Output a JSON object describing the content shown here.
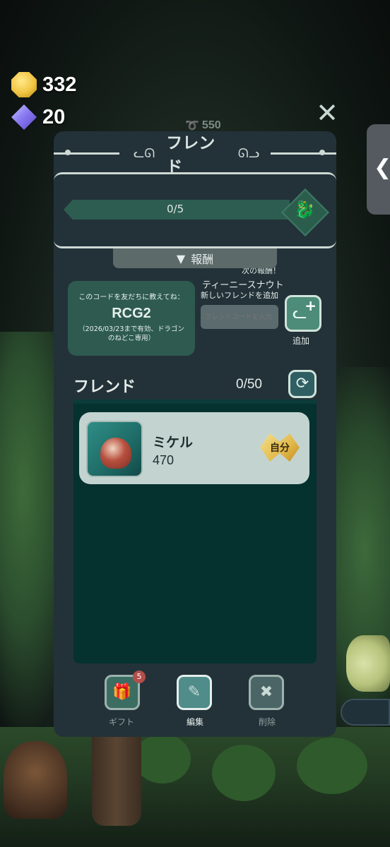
{
  "currencies": {
    "coins": "332",
    "gems": "20"
  },
  "ribbon_count": "550",
  "side_tab": {
    "icon": "chevron-left-icon"
  },
  "panel": {
    "title": "フレンド",
    "progress": {
      "text": "0/5",
      "value": 0,
      "max": 5,
      "next_reward_label": "次の報酬！",
      "next_reward_name": "ティーニースナウト"
    },
    "rewards_toggle": "報酬",
    "code_card": {
      "hint": "このコードを友だちに教えてね：",
      "code": "RCG2",
      "validity": "（2026/03/23まで有効、ドラゴンのねどこ専用）"
    },
    "add_friend": {
      "label": "新しいフレンドを追加",
      "placeholder": "フレンドコードを入力",
      "button_label": "追加"
    },
    "friends": {
      "heading": "フレンド",
      "count": "0/50",
      "list": [
        {
          "name": "ミケル",
          "score": "470",
          "badge": "自分"
        }
      ]
    },
    "bottom_actions": {
      "gift": {
        "label": "ギフト",
        "badge": "5"
      },
      "edit": {
        "label": "編集"
      },
      "delete": {
        "label": "削除"
      }
    }
  },
  "colors": {
    "panel_bg": "#233239",
    "accent_green": "#2e5a4f",
    "list_bg": "#05312f",
    "friend_row_bg": "#c3d4d0",
    "gift_badge": "#b34e4a"
  }
}
